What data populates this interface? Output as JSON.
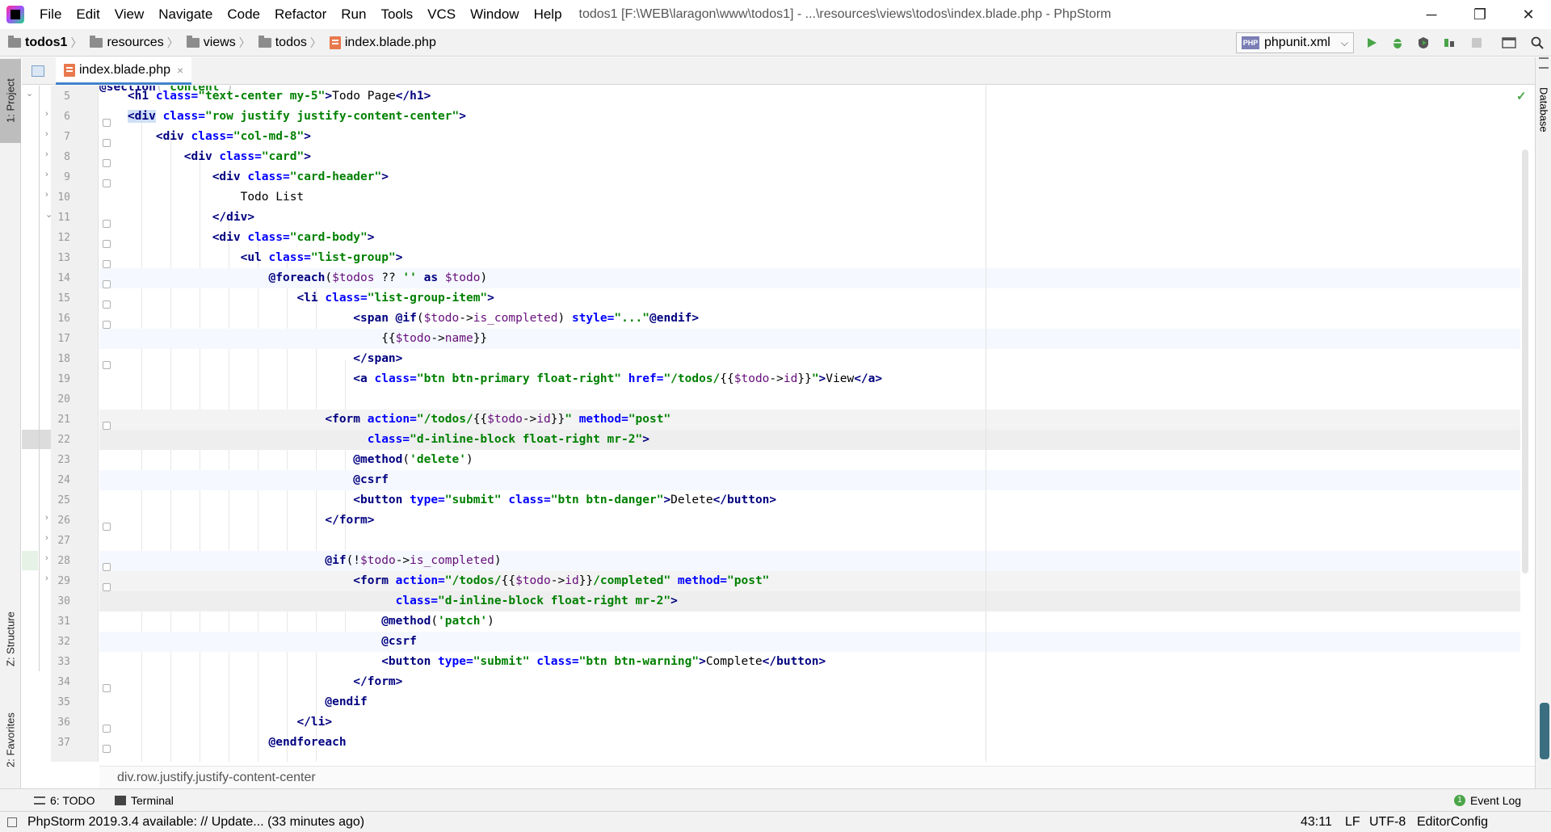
{
  "menubar": {
    "items": [
      "File",
      "Edit",
      "View",
      "Navigate",
      "Code",
      "Refactor",
      "Run",
      "Tools",
      "VCS",
      "Window",
      "Help"
    ],
    "title": "todos1 [F:\\WEB\\laragon\\www\\todos1] - ...\\resources\\views\\todos\\index.blade.php - PhpStorm"
  },
  "window_controls": {
    "minimize": "─",
    "restore": "❐",
    "close": "✕"
  },
  "navbar": {
    "crumbs": [
      "todos1",
      "resources",
      "views",
      "todos",
      "index.blade.php"
    ],
    "run_config": "phpunit.xml",
    "run_config_badge": "PHP"
  },
  "toolbar_icons": [
    "run-icon",
    "debug-icon",
    "coverage-icon",
    "profile-icon",
    "stop-icon",
    "project-structure-icon",
    "search-icon"
  ],
  "left_tabs": {
    "project": "1: Project",
    "structure": "Z: Structure",
    "favorites": "2: Favorites"
  },
  "right_tabs": {
    "database": "Database"
  },
  "editor_tab": {
    "label": "index.blade.php",
    "close": "×"
  },
  "code": {
    "line_numbers": [
      "5",
      "6",
      "7",
      "8",
      "9",
      "10",
      "11",
      "12",
      "13",
      "14",
      "15",
      "16",
      "17",
      "18",
      "19",
      "20",
      "21",
      "22",
      "23",
      "24",
      "25",
      "26",
      "27",
      "28",
      "29",
      "30",
      "31",
      "32",
      "33",
      "34",
      "35",
      "36",
      "37"
    ]
  },
  "breadcrumb_path": "div.row.justify.justify-content-center",
  "bottom_tabs": {
    "todo": "6: TODO",
    "terminal": "Terminal",
    "event_log": "Event Log",
    "event_count": "1"
  },
  "status": {
    "message": "PhpStorm 2019.3.4 available: // Update... (33 minutes ago)",
    "position": "43:11",
    "line_sep": "LF",
    "encoding": "UTF-8",
    "editorconfig": "EditorConfig"
  },
  "colors": {
    "accent": "#4083c9",
    "tag": "#000080",
    "attr": "#0000ff",
    "string": "#008000",
    "variable": "#660e7a"
  }
}
